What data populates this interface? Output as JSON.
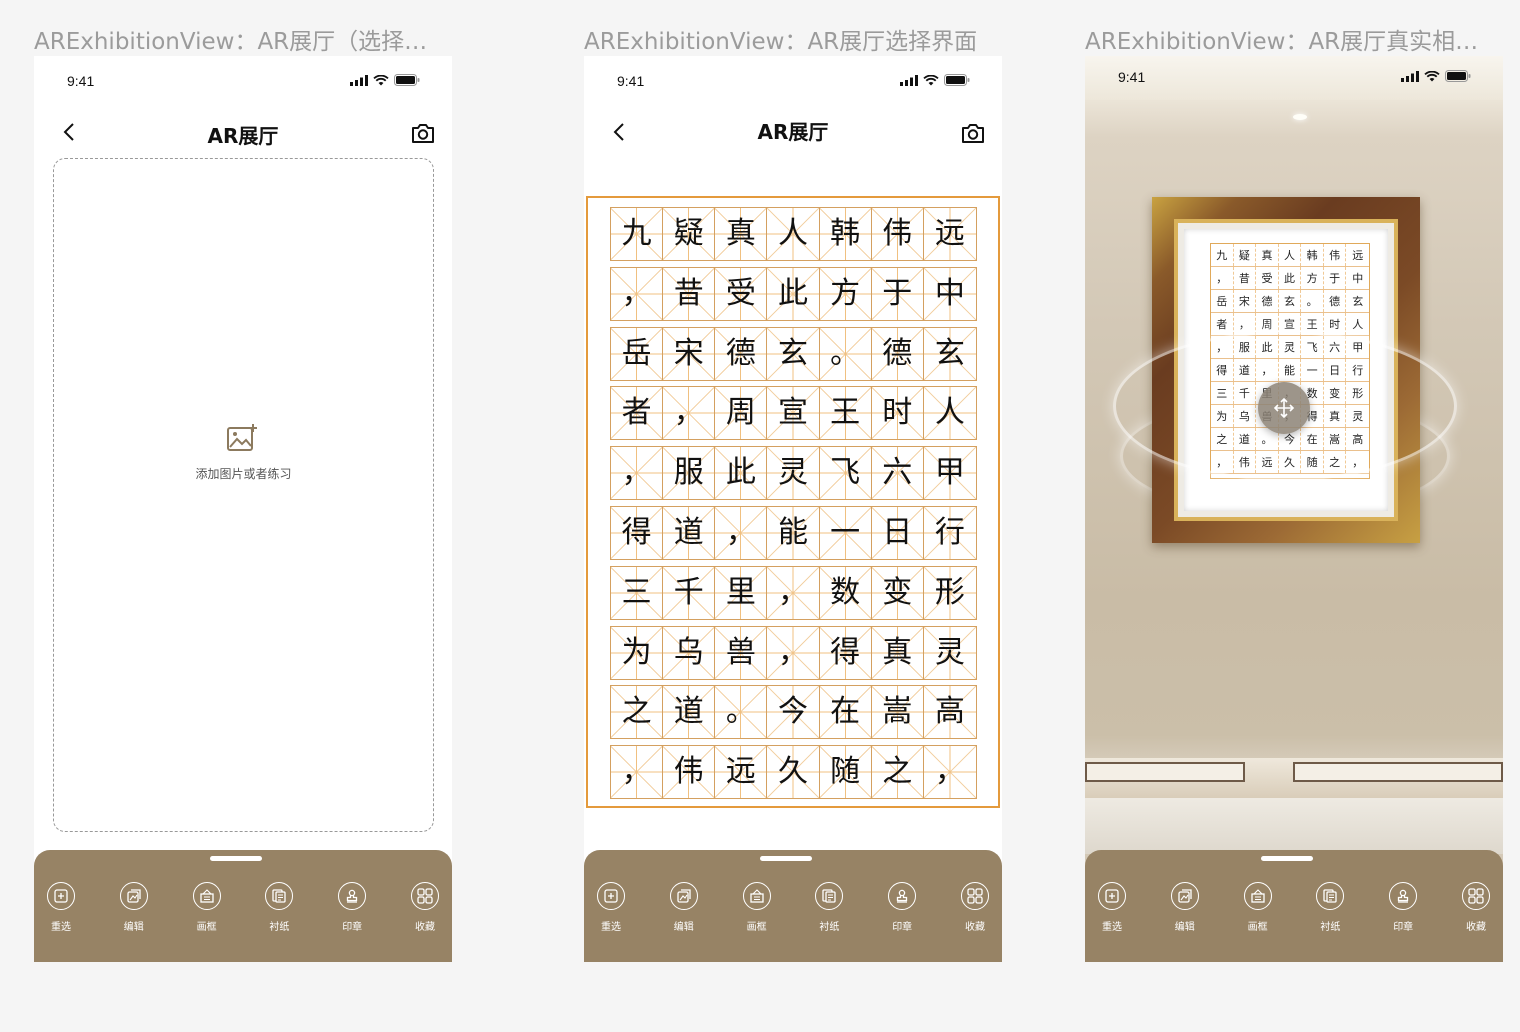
{
  "screens": [
    {
      "board_title": "ARExhibitionView：AR展厅（选择…",
      "time": "9:41",
      "nav_title": "AR展厅",
      "add_label": "添加图片或者练习"
    },
    {
      "board_title": "ARExhibitionView：AR展厅选择界面",
      "time": "9:41",
      "nav_title": "AR展厅"
    },
    {
      "board_title": "ARExhibitionView：AR展厅真实相…",
      "time": "9:41"
    }
  ],
  "practice_rows": [
    [
      "九",
      "疑",
      "真",
      "人",
      "韩",
      "伟",
      "远"
    ],
    [
      "，",
      "昔",
      "受",
      "此",
      "方",
      "于",
      "中"
    ],
    [
      "岳",
      "宋",
      "德",
      "玄",
      "。",
      "德",
      "玄"
    ],
    [
      "者",
      "，",
      "周",
      "宣",
      "王",
      "时",
      "人"
    ],
    [
      "，",
      "服",
      "此",
      "灵",
      "飞",
      "六",
      "甲"
    ],
    [
      "得",
      "道",
      "，",
      "能",
      "一",
      "日",
      "行"
    ],
    [
      "三",
      "千",
      "里",
      "，",
      "数",
      "变",
      "形"
    ],
    [
      "为",
      "乌",
      "兽",
      "，",
      "得",
      "真",
      "灵"
    ],
    [
      "之",
      "道",
      "。",
      "今",
      "在",
      "嵩",
      "高"
    ],
    [
      "，",
      "伟",
      "远",
      "久",
      "随",
      "之",
      "，"
    ]
  ],
  "toolbar": {
    "items": [
      {
        "label": "重选",
        "icon": "reselect-icon"
      },
      {
        "label": "编辑",
        "icon": "edit-icon"
      },
      {
        "label": "画框",
        "icon": "frame-icon"
      },
      {
        "label": "衬纸",
        "icon": "backing-paper-icon"
      },
      {
        "label": "印章",
        "icon": "seal-icon"
      },
      {
        "label": "收藏",
        "icon": "collection-icon"
      }
    ]
  },
  "colors": {
    "toolbar_bg": "#978365",
    "grid_orange": "#e49a3c",
    "frame_gold": "#c9a241"
  }
}
